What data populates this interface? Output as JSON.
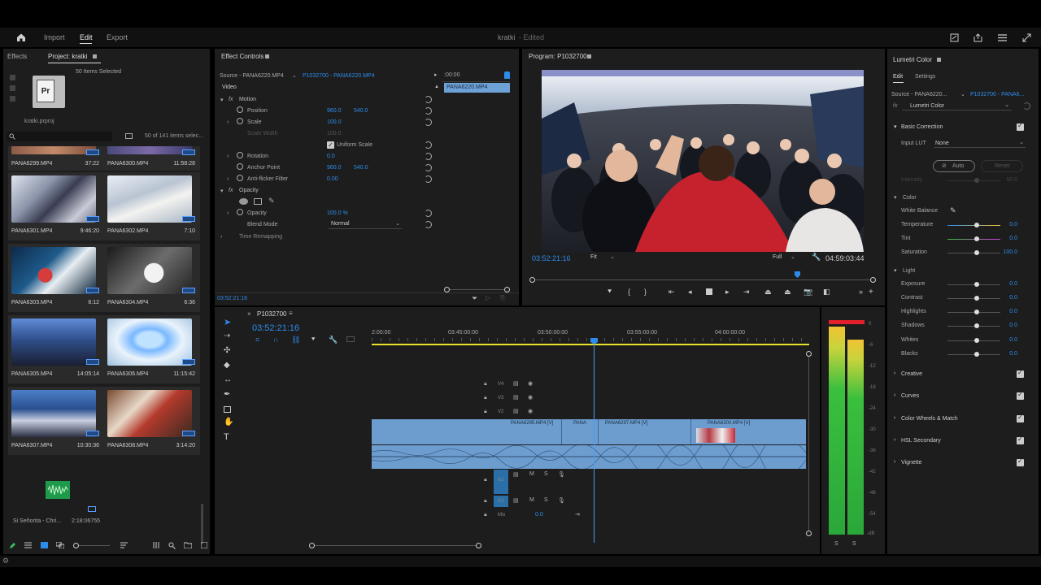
{
  "topbar": {
    "tabs": [
      "Import",
      "Edit",
      "Export"
    ],
    "active_tab": "Edit",
    "title": "kratki",
    "title_status": "- Edited"
  },
  "project": {
    "tab_effects": "Effects",
    "tab_project": "Project: kratki",
    "items_selected": "50 Items Selected",
    "file_name": "kratki.prproj",
    "count": "50 of 141 items selec...",
    "clips": [
      {
        "name": "PANA6299.MP4",
        "duration": "37:22"
      },
      {
        "name": "PANA6300.MP4",
        "duration": "11:58:28"
      },
      {
        "name": "PANA6301.MP4",
        "duration": "9:46:20"
      },
      {
        "name": "PANA6302.MP4",
        "duration": "7:10"
      },
      {
        "name": "PANA6303.MP4",
        "duration": "6:12"
      },
      {
        "name": "PANA6304.MP4",
        "duration": "6:36"
      },
      {
        "name": "PANA6305.MP4",
        "duration": "14:05:14"
      },
      {
        "name": "PANA6306.MP4",
        "duration": "11:15:42"
      },
      {
        "name": "PANA6307.MP4",
        "duration": "10:30:36"
      },
      {
        "name": "PANA6308.MP4",
        "duration": "3:14:20"
      }
    ],
    "audio_clip": {
      "name": "Si Señorita - Chri...",
      "duration": "2:18:06755"
    }
  },
  "effect_controls": {
    "tab": "Effect Controls",
    "source": "Source - PANA6220.MP4",
    "sequence_clip": "P1032700 - PANA6220.MP4",
    "timecode_start": ":00:00",
    "clip_label": "PANA6220.MP4",
    "video_label": "Video",
    "motion": "Motion",
    "position_label": "Position",
    "position_x": "960.0",
    "position_y": "540.0",
    "scale_label": "Scale",
    "scale_value": "100.0",
    "scale_width_label": "Scale Width",
    "scale_width_value": "100.0",
    "uniform_scale": "Uniform Scale",
    "rotation_label": "Rotation",
    "rotation_value": "0.0",
    "anchor_label": "Anchor Point",
    "anchor_x": "960.0",
    "anchor_y": "540.0",
    "antiflicker_label": "Anti-flicker Filter",
    "antiflicker_value": "0.00",
    "opacity_group": "Opacity",
    "opacity_label": "Opacity",
    "opacity_value": "100.0 %",
    "blend_label": "Blend Mode",
    "blend_value": "Normal",
    "time_remap": "Time Remapping",
    "current_time": "03:52:21:16"
  },
  "program": {
    "tab": "Program: P1032700",
    "timecode": "03:52:21:16",
    "fit": "Fit",
    "quality": "Full",
    "duration": "04:59:03:44"
  },
  "timeline": {
    "sequence": "P1032700",
    "timecode": "03:52:21:16",
    "ruler": [
      "2:00:00",
      "03:45:00:00",
      "03:50:00:00",
      "03:55:00:00",
      "04:00:00:00"
    ],
    "video_tracks": [
      "V4",
      "V3",
      "V2",
      "V1"
    ],
    "audio_tracks": [
      "A1",
      "A2",
      "A3"
    ],
    "mix_label": "Mix",
    "mix_value": "0.0",
    "clips": [
      "PANA6295.MP4 [V]",
      "PANA",
      "PANA6297.MP4 [V]",
      "PANA6300.MP4 [V]"
    ]
  },
  "meter": {
    "scale": [
      "0",
      "-6",
      "-12",
      "-18",
      "-24",
      "-30",
      "-36",
      "-42",
      "-48",
      "-54",
      "-dB"
    ],
    "solo_labels": [
      "S",
      "S"
    ]
  },
  "lumetri": {
    "tab": "Lumetri Color",
    "sub_tabs": [
      "Edit",
      "Settings"
    ],
    "source": "Source - PANA6220...",
    "target": "P1032700 - PANA6...",
    "effect": "Lumetri Color",
    "basic_correction": "Basic Correction",
    "input_lut_label": "Input LUT",
    "input_lut_value": "None",
    "auto_label": "Auto",
    "reset_label": "Reset",
    "intensity_label": "Intensity",
    "intensity_value": "50.0",
    "color_section": "Color",
    "white_balance": "White Balance",
    "color_rows": [
      {
        "label": "Temperature",
        "value": "0.0"
      },
      {
        "label": "Tint",
        "value": "0.0"
      },
      {
        "label": "Saturation",
        "value": "100.0"
      }
    ],
    "light_section": "Light",
    "light_rows": [
      {
        "label": "Exposure",
        "value": "0.0"
      },
      {
        "label": "Contrast",
        "value": "0.0"
      },
      {
        "label": "Highlights",
        "value": "0.0"
      },
      {
        "label": "Shadows",
        "value": "0.0"
      },
      {
        "label": "Whites",
        "value": "0.0"
      },
      {
        "label": "Blacks",
        "value": "0.0"
      }
    ],
    "sections": [
      "Creative",
      "Curves",
      "Color Wheels & Match",
      "HSL Secondary",
      "Vignette"
    ]
  }
}
